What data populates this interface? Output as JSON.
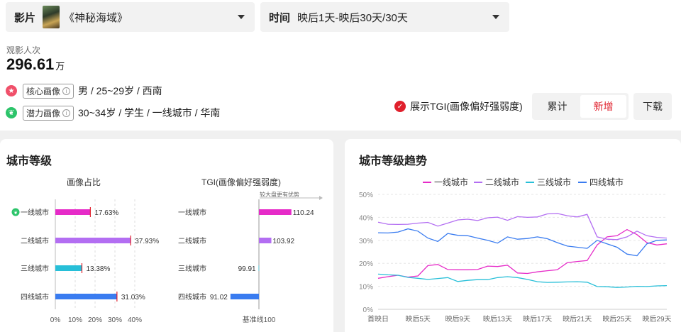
{
  "film_select": {
    "label": "影片",
    "value": "《神秘海域》"
  },
  "time_select": {
    "label": "时间",
    "value": "映后1天-映后30天/30天"
  },
  "viewers": {
    "label": "观影人次",
    "value": "296.61",
    "unit": "万"
  },
  "core_persona": {
    "tag": "核心画像",
    "info": "i",
    "text": "男 / 25~29岁 / 西南"
  },
  "potential_persona": {
    "tag": "潜力画像",
    "info": "i",
    "text": "30~34岁 / 学生 / 一线城市 / 华南"
  },
  "tgi_toggle": {
    "label": "展示TGI(画像偏好强弱度)",
    "checked": true
  },
  "mode_tabs": [
    {
      "label": "累计",
      "active": false
    },
    {
      "label": "新增",
      "active": true
    }
  ],
  "download_label": "下载",
  "colors": {
    "accent": "#e0202c",
    "tier1": "#e62bc8",
    "tier2": "#b36ef2",
    "tier3": "#27bfd8",
    "tier4": "#3a7cf0"
  },
  "left_card": {
    "title": "城市等级",
    "ratio_header": "画像占比",
    "tgi_header": "TGI(画像偏好强弱度)",
    "tgi_note": "较大盘更有优势",
    "baseline_label": "基准线100"
  },
  "right_card": {
    "title": "城市等级趋势"
  },
  "chart_data": [
    {
      "type": "bar",
      "title": "画像占比",
      "categories": [
        "一线城市",
        "二线城市",
        "三线城市",
        "四线城市"
      ],
      "values": [
        17.63,
        37.93,
        13.38,
        31.03
      ],
      "value_labels": [
        "17.63%",
        "37.93%",
        "13.38%",
        "31.03%"
      ],
      "xlim": [
        0,
        40
      ],
      "xticks": [
        "0%",
        "10%",
        "20%",
        "30%",
        "40%"
      ],
      "orientation": "horizontal"
    },
    {
      "type": "bar",
      "title": "TGI(画像偏好强弱度)",
      "categories": [
        "一线城市",
        "二线城市",
        "三线城市",
        "四线城市"
      ],
      "values": [
        110.24,
        103.92,
        99.91,
        91.02
      ],
      "value_labels": [
        "110.24",
        "103.92",
        "99.91",
        "91.02"
      ],
      "baseline": 100,
      "orientation": "horizontal"
    },
    {
      "type": "line",
      "title": "城市等级趋势",
      "x": [
        "首映日",
        "映后2天",
        "映后3天",
        "映后4天",
        "映后5天",
        "映后6天",
        "映后7天",
        "映后8天",
        "映后9天",
        "映后10天",
        "映后11天",
        "映后12天",
        "映后13天",
        "映后14天",
        "映后15天",
        "映后16天",
        "映后17天",
        "映后18天",
        "映后19天",
        "映后20天",
        "映后21天",
        "映后22天",
        "映后23天",
        "映后24天",
        "映后25天",
        "映后26天",
        "映后27天",
        "映后28天",
        "映后29天",
        "映后30天"
      ],
      "xticks": [
        "首映日",
        "映后5天",
        "映后9天",
        "映后13天",
        "映后17天",
        "映后21天",
        "映后25天",
        "映后29天"
      ],
      "yticks": [
        "0%",
        "10%",
        "20%",
        "30%",
        "40%",
        "50%"
      ],
      "ylim": [
        0,
        50
      ],
      "series": [
        {
          "name": "一线城市",
          "values": [
            13.5,
            14.2,
            14.8,
            14.0,
            14.5,
            19.0,
            19.5,
            17.3,
            17.2,
            17.2,
            17.3,
            18.8,
            18.6,
            19.2,
            15.8,
            15.6,
            16.3,
            16.8,
            17.2,
            20.3,
            20.8,
            21.2,
            28.0,
            31.5,
            32.0,
            34.7,
            32.5,
            29.0,
            28.0,
            28.5
          ]
        },
        {
          "name": "二线城市",
          "values": [
            37.9,
            37.0,
            36.9,
            37.0,
            37.5,
            37.8,
            36.2,
            37.5,
            38.9,
            39.2,
            38.6,
            39.8,
            40.1,
            38.7,
            40.3,
            40.0,
            40.2,
            41.5,
            41.7,
            40.7,
            40.2,
            41.3,
            31.5,
            30.5,
            30.3,
            31.5,
            34.0,
            32.0,
            31.3,
            31.0
          ]
        },
        {
          "name": "三线城市",
          "values": [
            15.3,
            15.0,
            14.8,
            13.9,
            13.5,
            13.0,
            13.4,
            13.8,
            12.1,
            12.6,
            12.9,
            12.9,
            13.8,
            14.2,
            13.8,
            13.0,
            12.0,
            11.7,
            11.8,
            11.9,
            12.0,
            11.8,
            9.9,
            9.8,
            9.5,
            9.7,
            10.0,
            9.9,
            10.2,
            10.3
          ]
        },
        {
          "name": "四线城市",
          "values": [
            33.3,
            33.2,
            33.6,
            35.0,
            34.0,
            31.0,
            29.5,
            33.0,
            32.2,
            32.0,
            31.0,
            30.0,
            28.8,
            31.5,
            30.5,
            30.8,
            31.5,
            30.7,
            29.0,
            27.5,
            27.0,
            26.5,
            30.0,
            28.5,
            27.0,
            24.0,
            23.3,
            28.5,
            30.0,
            30.2
          ]
        }
      ],
      "legend": "top"
    }
  ]
}
